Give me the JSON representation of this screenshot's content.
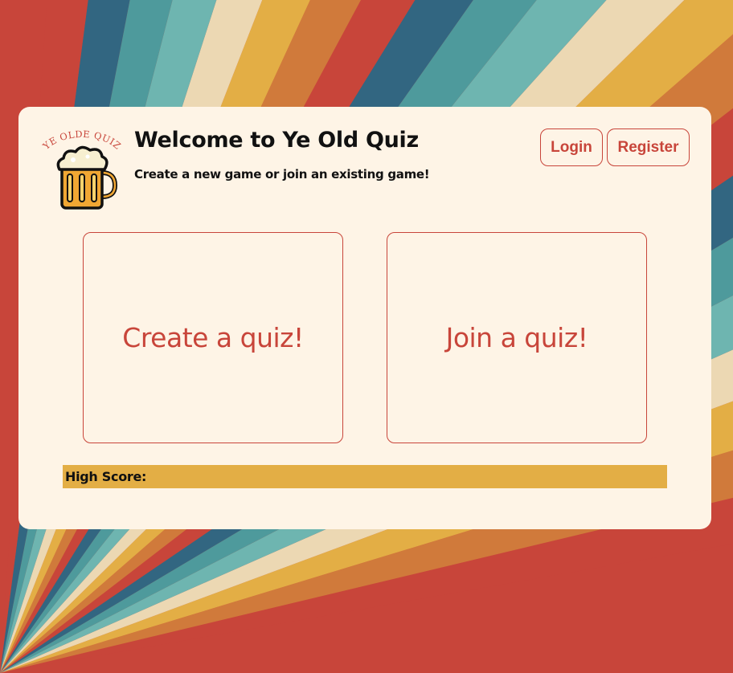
{
  "theme": {
    "card_background": "#fef4e6",
    "accent": "#c8453a",
    "highscore_bar": "#e3ae45",
    "stripe_colors": [
      "#c8453a",
      "#d07a3b",
      "#e3ae45",
      "#ecd8b3",
      "#6eb5b0",
      "#4e9a9c",
      "#326681"
    ]
  },
  "logo": {
    "icon": "beer-mug-icon",
    "text": "YE OLDE QUIZ"
  },
  "header": {
    "title": "Welcome to Ye Old Quiz",
    "subtitle": "Create a new game or join an existing game!"
  },
  "auth": {
    "login_label": "Login",
    "register_label": "Register"
  },
  "options": {
    "create_label": "Create a quiz!",
    "join_label": "Join a quiz!"
  },
  "highscore": {
    "label": "High Score:"
  }
}
